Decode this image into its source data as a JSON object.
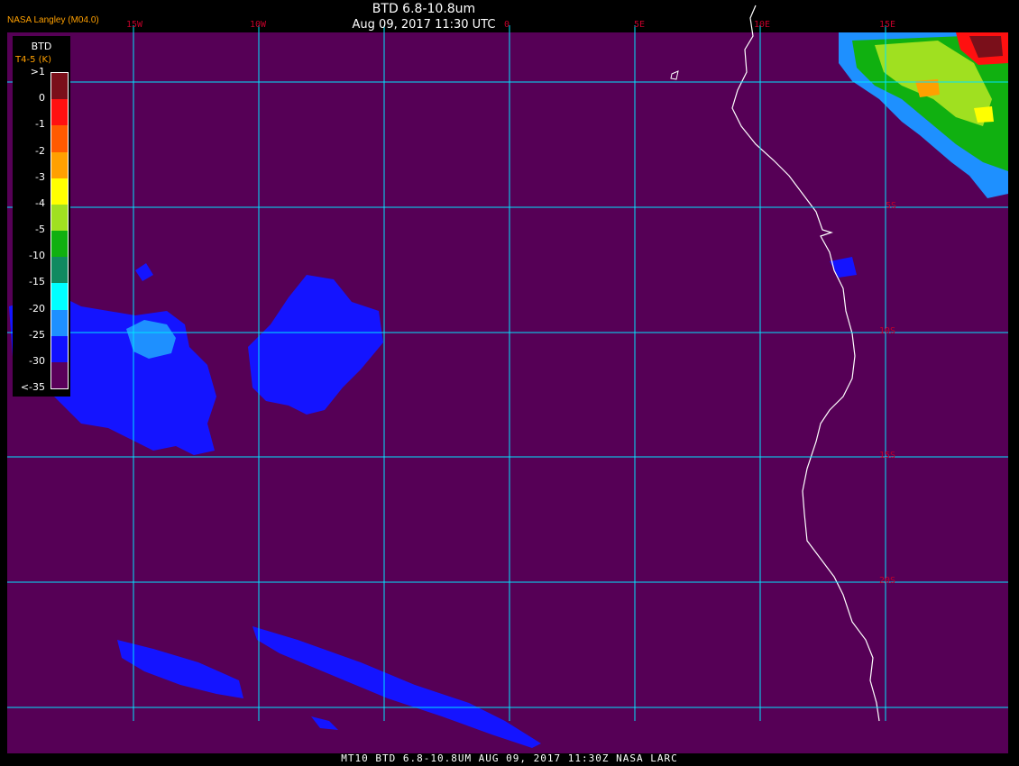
{
  "header": {
    "credit": "NASA Langley (M04.0)",
    "title": "BTD 6.8-10.8um",
    "subtitle": "Aug 09, 2017 11:30 UTC"
  },
  "footer": "MT10  BTD 6.8-10.8UM  AUG 09, 2017 11:30Z  NASA LARC",
  "longitude_labels": [
    "15W",
    "10W",
    "0",
    "5E",
    "10E",
    "15E"
  ],
  "latitude_labels": [
    "5S",
    "10S",
    "15S",
    "20S"
  ],
  "legend": {
    "title": "BTD",
    "units": "T4-5 (K)",
    "labels": [
      ">1",
      "0",
      "-1",
      "-2",
      "-3",
      "-4",
      "-5",
      "-10",
      "-15",
      "-20",
      "-25",
      "-30",
      "<-35"
    ],
    "colors": [
      "#7a0f1a",
      "#ff1010",
      "#ff5a00",
      "#ffa000",
      "#ffff00",
      "#a0e020",
      "#10b010",
      "#108a60",
      "#00ffff",
      "#1e90ff",
      "#1010ff",
      "#5a005a"
    ]
  },
  "colors": {
    "background": "#560056",
    "grid": "#00e5ff",
    "coastline": "#ffffff",
    "cloud_blue": "#1414ff",
    "cloud_lightblue": "#1e90ff"
  }
}
